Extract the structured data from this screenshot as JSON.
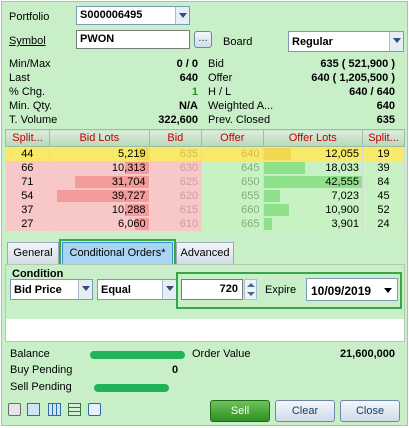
{
  "order_form": {
    "portfolio": {
      "label": "Portfolio",
      "value": "S000006495"
    },
    "symbol": {
      "label": "Symbol",
      "value": "PWON",
      "browse_label": "..."
    },
    "board": {
      "label": "Board",
      "value": "Regular"
    }
  },
  "quote": {
    "left": [
      {
        "label": "Min/Max",
        "value": "0 / 0"
      },
      {
        "label": "Last",
        "value": "640"
      },
      {
        "label": "% Chg.",
        "value": "1"
      },
      {
        "label": "Min. Qty.",
        "value": "N/A"
      },
      {
        "label": "T. Volume",
        "value": "322,600"
      }
    ],
    "right": [
      {
        "label": "Bid",
        "value": "635 ( 521,900 )"
      },
      {
        "label": "Offer",
        "value": "640 ( 1,205,500 )"
      },
      {
        "label": "H / L",
        "value": "640 / 640"
      },
      {
        "label": "Weighted A...",
        "value": "640"
      },
      {
        "label": "Prev. Closed",
        "value": "635"
      }
    ]
  },
  "depth": {
    "headers": [
      "Split...",
      "Bid Lots",
      "Bid",
      "Offer",
      "Offer Lots",
      "Split..."
    ],
    "rows": [
      {
        "split_bid": "44",
        "bid_lots": "5,219",
        "bid": "635",
        "offer": "640",
        "offer_lots": "12,055",
        "split_offer": "19",
        "bid_lots_n": 5219,
        "offer_lots_n": 12055
      },
      {
        "split_bid": "66",
        "bid_lots": "10,313",
        "bid": "630",
        "offer": "645",
        "offer_lots": "18,033",
        "split_offer": "39",
        "bid_lots_n": 10313,
        "offer_lots_n": 18033
      },
      {
        "split_bid": "71",
        "bid_lots": "31,704",
        "bid": "625",
        "offer": "650",
        "offer_lots": "42,555",
        "split_offer": "84",
        "bid_lots_n": 31704,
        "offer_lots_n": 42555
      },
      {
        "split_bid": "54",
        "bid_lots": "39,727",
        "bid": "620",
        "offer": "655",
        "offer_lots": "7,023",
        "split_offer": "45",
        "bid_lots_n": 39727,
        "offer_lots_n": 7023
      },
      {
        "split_bid": "37",
        "bid_lots": "10,288",
        "bid": "615",
        "offer": "660",
        "offer_lots": "10,900",
        "split_offer": "52",
        "bid_lots_n": 10288,
        "offer_lots_n": 10900
      },
      {
        "split_bid": "27",
        "bid_lots": "6,060",
        "bid": "610",
        "offer": "665",
        "offer_lots": "3,901",
        "split_offer": "24",
        "bid_lots_n": 6060,
        "offer_lots_n": 3901
      }
    ]
  },
  "tabs": [
    {
      "label": "General",
      "active": false
    },
    {
      "label": "Conditional Orders*",
      "active": true
    },
    {
      "label": "Advanced",
      "active": false
    }
  ],
  "condition": {
    "title": "Condition",
    "field": "Bid Price",
    "operator": "Equal",
    "price": "720",
    "expire_label": "Expire",
    "expire_date": "10/09/2019"
  },
  "summary": {
    "balance_label": "Balance",
    "order_value_label": "Order Value",
    "order_value": "21,600,000",
    "buy_pending_label": "Buy Pending",
    "buy_pending": "0",
    "sell_pending_label": "Sell Pending"
  },
  "buttons": {
    "sell": "Sell",
    "clear": "Clear",
    "close": "Close"
  },
  "toolbar_icons": [
    "lock-icon",
    "calculator-icon",
    "grid-icon",
    "table-icon",
    "calendar-clock-icon"
  ],
  "colors": {
    "bid_row": "#f8c7c7",
    "offer_row": "#c8f2c3",
    "best_row": "#f8ea68",
    "header_text": "#c00000",
    "highlight": "#3aa64a",
    "sell_button": "#3f9b2e"
  }
}
